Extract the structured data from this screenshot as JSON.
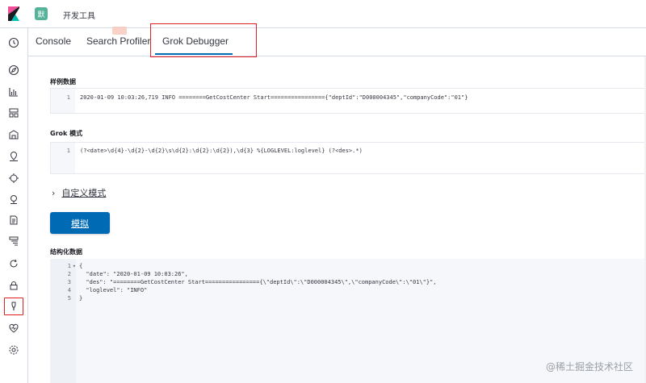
{
  "header": {
    "space_initial": "默",
    "breadcrumb": "开发工具"
  },
  "tabs": [
    {
      "label": "Console"
    },
    {
      "label": "Search Profiler"
    },
    {
      "label": "Grok Debugger"
    }
  ],
  "sample_data": {
    "title": "样例数据",
    "lines": [
      "2020-01-09 10:03:26,719 INFO ========GetCostCenter Start================{\"deptId\":\"D000004345\",\"companyCode\":\"01\"}"
    ]
  },
  "grok_pattern": {
    "title": "Grok 模式",
    "lines": [
      "(?<date>\\d{4}-\\d{2}-\\d{2}\\s\\d{2}:\\d{2}:\\d{2}),\\d{3} %{LOGLEVEL:loglevel} (?<des>.*)"
    ]
  },
  "custom_patterns": {
    "label": "自定义模式"
  },
  "simulate_button": {
    "label": "模拟"
  },
  "structured_data": {
    "title": "结构化数据",
    "lines": [
      "{",
      "  \"date\": \"2020-01-09 10:03:26\",",
      "  \"des\": \"========GetCostCenter Start================{\\\"deptId\\\":\\\"D000004345\\\",\\\"companyCode\\\":\\\"01\\\"}\",",
      "  \"loglevel\": \"INFO\"",
      "}"
    ]
  },
  "watermark": "@稀土掘金技术社区",
  "colors": {
    "accent": "#006bb4",
    "highlight": "#e02020",
    "space_badge": "#54b399"
  }
}
